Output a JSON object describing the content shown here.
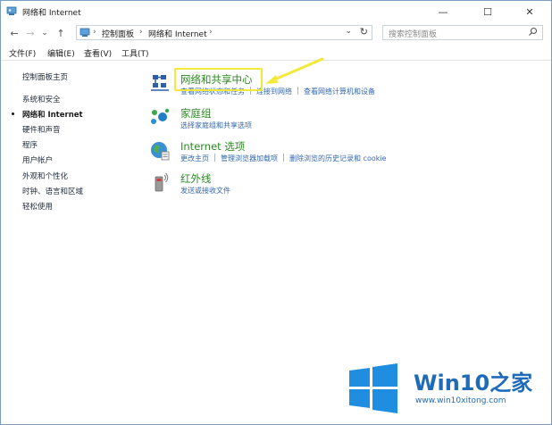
{
  "window": {
    "title": "网络和 Internet",
    "controls": {
      "minimize": "—",
      "maximize": "☐",
      "close": "✕"
    }
  },
  "nav": {
    "back": "←",
    "forward": "→",
    "recent": "⌄",
    "up": "↑"
  },
  "address": {
    "separator": "›",
    "crumbs": [
      "控制面板",
      "网络和 Internet"
    ],
    "dropdown": "⌄",
    "refresh": "↻"
  },
  "search": {
    "placeholder": "搜索控制面板"
  },
  "menu": {
    "items": [
      "文件(F)",
      "编辑(E)",
      "查看(V)",
      "工具(T)"
    ]
  },
  "sidebar": {
    "items": [
      {
        "label": "控制面板主页",
        "active": false
      },
      {
        "label": "系统和安全",
        "active": false
      },
      {
        "label": "网络和 Internet",
        "active": true
      },
      {
        "label": "硬件和声音",
        "active": false
      },
      {
        "label": "程序",
        "active": false
      },
      {
        "label": "用户帐户",
        "active": false
      },
      {
        "label": "外观和个性化",
        "active": false
      },
      {
        "label": "时钟、语言和区域",
        "active": false
      },
      {
        "label": "轻松使用",
        "active": false
      }
    ]
  },
  "categories": [
    {
      "title": "网络和共享中心",
      "icon": "network-sharing-icon",
      "links": [
        "查看网络状态和任务",
        "连接到网络",
        "查看网络计算机和设备"
      ]
    },
    {
      "title": "家庭组",
      "icon": "homegroup-icon",
      "links": [
        "选择家庭组和共享选项"
      ]
    },
    {
      "title": "Internet 选项",
      "icon": "internet-options-icon",
      "links": [
        "更改主页",
        "管理浏览器加载项",
        "删除浏览的历史记录和 cookie"
      ]
    },
    {
      "title": "红外线",
      "icon": "infrared-icon",
      "links": [
        "发送或接收文件"
      ]
    }
  ],
  "watermark": {
    "brand_main": "Win10",
    "brand_suffix": "之家",
    "url": "www.win10xitong.com"
  },
  "colors": {
    "category_title": "#2b8a22",
    "link": "#3468b0",
    "highlight": "#f3e93a",
    "watermark": "#1f6bb8"
  }
}
